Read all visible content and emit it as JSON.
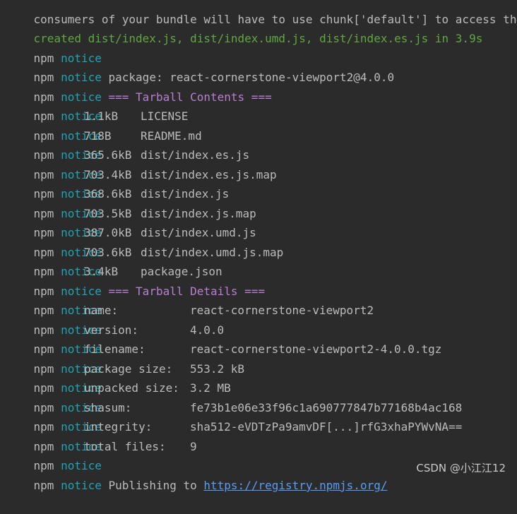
{
  "header": {
    "truncated_line": "consumers of your bundle will have to use chunk['default'] to access their",
    "created": {
      "label": "created",
      "files": "dist/index.js, dist/index.umd.js, dist/index.es.js",
      "in": "in",
      "time": "3.9s"
    }
  },
  "prefix": {
    "npm": "npm",
    "notice": "notice"
  },
  "package_line": "package: react-cornerstone-viewport2@4.0.0",
  "tarball_contents_header": "=== Tarball Contents ===",
  "tarball_contents": [
    {
      "size": "1.1kB",
      "file": "LICENSE"
    },
    {
      "size": "718B",
      "file": "README.md"
    },
    {
      "size": "365.6kB",
      "file": "dist/index.es.js"
    },
    {
      "size": "703.4kB",
      "file": "dist/index.es.js.map"
    },
    {
      "size": "368.6kB",
      "file": "dist/index.js"
    },
    {
      "size": "703.5kB",
      "file": "dist/index.js.map"
    },
    {
      "size": "387.0kB",
      "file": "dist/index.umd.js"
    },
    {
      "size": "703.6kB",
      "file": "dist/index.umd.js.map"
    },
    {
      "size": "3.4kB",
      "file": "package.json"
    }
  ],
  "tarball_details_header": "=== Tarball Details ===",
  "tarball_details": [
    {
      "key": "name:",
      "value": "react-cornerstone-viewport2"
    },
    {
      "key": "version:",
      "value": "4.0.0"
    },
    {
      "key": "filename:",
      "value": "react-cornerstone-viewport2-4.0.0.tgz"
    },
    {
      "key": "package size:",
      "value": "553.2 kB"
    },
    {
      "key": "unpacked size:",
      "value": "3.2 MB"
    },
    {
      "key": "shasum:",
      "value": "fe73b1e06e33f96c1a690777847b77168b4ac168"
    },
    {
      "key": "integrity:",
      "value": "sha512-eVDTzPa9amvDF[...]rfG3xhaPYWvNA=="
    },
    {
      "key": "total files:",
      "value": "9"
    }
  ],
  "publishing": {
    "text": "Publishing to",
    "url": "https://registry.npmjs.org/"
  },
  "watermark": "CSDN @小江江12",
  "colors": {
    "background": "#2b2b2b",
    "text": "#bbbbbb",
    "notice": "#21a4b2",
    "green": "#5fa840",
    "magenta": "#b97ed1",
    "link": "#589df6"
  }
}
